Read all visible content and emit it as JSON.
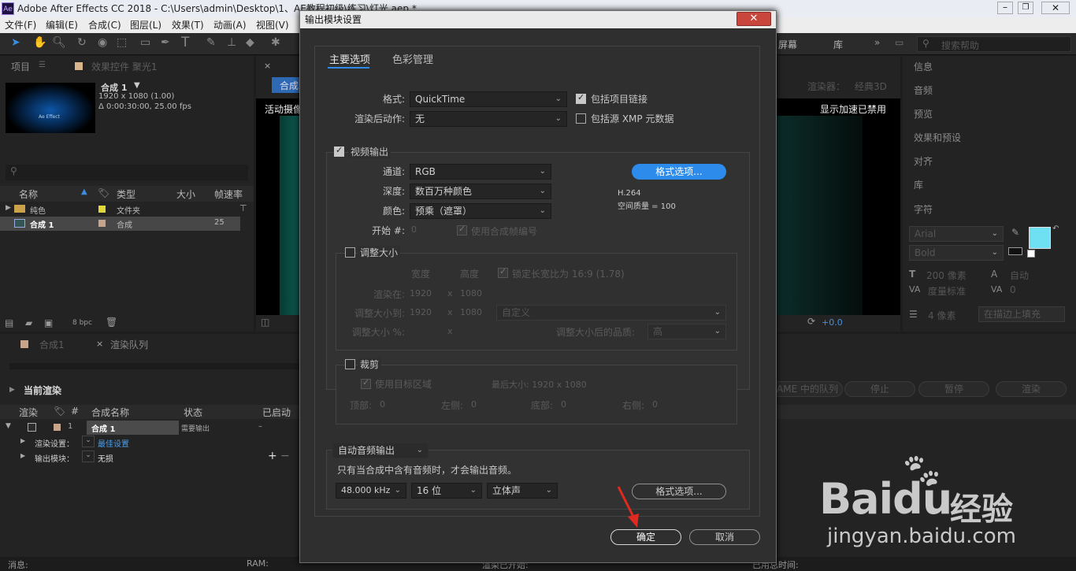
{
  "window": {
    "title": "Adobe After Effects CC 2018 - C:\\Users\\admin\\Desktop\\1、AE教程初级\\练习\\灯光.aep *"
  },
  "menu": [
    "文件(F)",
    "编辑(E)",
    "合成(C)",
    "图层(L)",
    "效果(T)",
    "动画(A)",
    "视图(V)"
  ],
  "toolbar": {
    "right": [
      "屏幕",
      "库"
    ],
    "search_placeholder": "搜索帮助"
  },
  "project": {
    "tab1": "项目",
    "tab2": "效果控件 聚光1",
    "comp_name": "合成 1",
    "comp_res": "1920 x 1080 (1.00)",
    "comp_dur": "Δ 0:00:30:00, 25.00 fps",
    "thumb_text": "Ae Effect",
    "cols": {
      "name": "名称",
      "type": "类型",
      "size": "大小",
      "rate": "帧速率"
    },
    "rows": [
      {
        "name": "纯色",
        "type": "文件夹",
        "rate": ""
      },
      {
        "name": "合成 1",
        "type": "合成",
        "rate": "25"
      }
    ],
    "bpc": "8 bpc"
  },
  "viewer": {
    "tab": "合成",
    "text_left": "活动摄像",
    "text_right": "显示加速已禁用",
    "renderer_label": "渲染器：",
    "renderer": "经典3D",
    "exposure": "+0.0"
  },
  "rightpanel": {
    "items": [
      "信息",
      "音频",
      "预览",
      "效果和预设",
      "对齐",
      "库",
      "字符"
    ],
    "font": "Arial",
    "style": "Bold",
    "size": "200 像素",
    "auto": "自动",
    "metric": "度量标准",
    "zero": "0",
    "stroke": "4 像素",
    "stroke_mode": "在描边上填充"
  },
  "timeline": {
    "tab1": "合成1",
    "tab2": "渲染队列",
    "current": "当前渲染",
    "cols": {
      "render": "渲染",
      "num": "#",
      "comp": "合成名称",
      "status": "状态",
      "started": "已启动"
    },
    "row": {
      "num": "1",
      "comp": "合成 1",
      "status": "需要输出",
      "started": "–"
    },
    "render_settings_label": "渲染设置：",
    "render_settings": "最佳设置",
    "output_module_label": "输出模块：",
    "output_module": "无损",
    "queue_buttons": [
      "AME 中的队列",
      "停止",
      "暂停",
      "渲染"
    ],
    "status": {
      "msg": "消息:",
      "ram": "RAM:",
      "render_started": "渲染已开始:",
      "elapsed": "已用总时间:"
    }
  },
  "dialog": {
    "title": "输出模块设置",
    "close": "✕",
    "tabs": [
      "主要选项",
      "色彩管理"
    ],
    "format_label": "格式:",
    "format": "QuickTime",
    "post_label": "渲染后动作:",
    "post": "无",
    "include_link": "包括项目链接",
    "include_xmp": "包括源 XMP 元数据",
    "video_output": "视频输出",
    "channel_label": "通道:",
    "channel": "RGB",
    "depth_label": "深度:",
    "depth": "数百万种颜色",
    "color_label": "颜色:",
    "color": "预乘（遮罩）",
    "start_label": "开始 #:",
    "start_value": "0",
    "use_comp_frame": "使用合成帧编号",
    "format_options": "格式选项...",
    "codec": "H.264",
    "quality": "空间质量 = 100",
    "resize": "调整大小",
    "width": "宽度",
    "height": "高度",
    "lock_aspect": "锁定长宽比为 16:9 (1.78)",
    "render_at": "渲染在:",
    "render_w": "1920",
    "render_h": "1080",
    "x": "x",
    "resize_to": "调整大小到:",
    "resize_w": "1920",
    "resize_h": "1080",
    "custom": "自定义",
    "resize_pct": "调整大小 %:",
    "resize_quality": "调整大小后的品质:",
    "quality_high": "高",
    "crop": "裁剪",
    "use_roi": "使用目标区域",
    "final_size": "最后大小: 1920 x 1080",
    "top": "顶部:",
    "left": "左侧:",
    "bottom": "底部:",
    "right": "右侧:",
    "zero": "0",
    "audio_mode": "自动音频输出",
    "audio_note": "只有当合成中含有音频时，才会输出音频。",
    "sample": "48.000 kHz",
    "bits": "16 位",
    "channels": "立体声",
    "audio_format_options": "格式选项...",
    "ok": "确定",
    "cancel": "取消"
  },
  "watermark": {
    "brand": "Baidu",
    "cn": "经验",
    "url": "jingyan.baidu.com"
  }
}
